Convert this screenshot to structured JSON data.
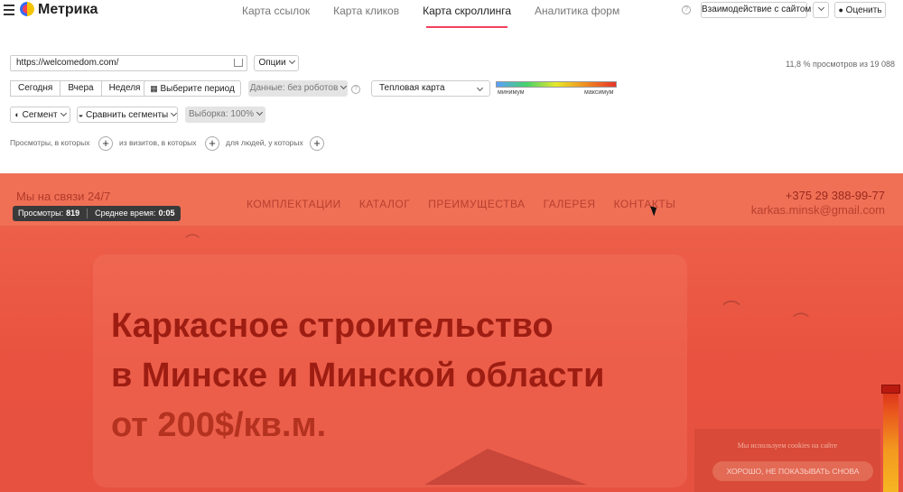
{
  "app": {
    "brand": "Метрика",
    "tabs": [
      {
        "label": "Карта ссылок"
      },
      {
        "label": "Карта кликов"
      },
      {
        "label": "Карта скроллинга"
      },
      {
        "label": "Аналитика форм"
      }
    ],
    "interaction_button": "Взаимодействие с сайтом",
    "rate_button": "Оценить",
    "help_glyph": "?"
  },
  "controls": {
    "url_value": "https://welcomedom.com/",
    "options_label": "Опции",
    "views_info": "11,8 % просмотров из 19 088",
    "period": [
      "Сегодня",
      "Вчера",
      "Неделя"
    ],
    "choose_period": "Выберите период",
    "data_filter": "Данные: без роботов",
    "map_type": "Тепловая карта",
    "legend_min": "минимум",
    "legend_max": "максимум",
    "segment": "Сегмент",
    "compare_segments": "Сравнить сегменты",
    "sample": "Выборка: 100%",
    "filter_1": "Просмотры, в которых",
    "filter_2": "из визитов, в которых",
    "filter_3": "для людей, у которых",
    "plus": "+"
  },
  "site": {
    "tagline": "Мы на связи 24/7",
    "nav": [
      "КОМПЛЕКТАЦИИ",
      "КАТАЛОГ",
      "ПРЕИМУЩЕСТВА",
      "ГАЛЕРЕЯ",
      "КОНТАКТЫ"
    ],
    "phone": "+375 29 388-99-77",
    "email": "karkas.minsk@gmail.com",
    "tooltip": {
      "views_label": "Просмотры:",
      "views_value": "819",
      "time_label": "Среднее время:",
      "time_value": "0:05"
    },
    "hero_line1": "Каркасное строительство",
    "hero_line2": "в Минске и Минской области",
    "hero_line3": "от 200$/кв.м.",
    "cookie_text": "Мы используем cookies на сайте",
    "cookie_button": "ХОРОШО, НЕ ПОКАЗЫВАТЬ СНОВА"
  },
  "colors": {
    "accent": "#f5405a",
    "heatmap_red": "#e8523f"
  }
}
